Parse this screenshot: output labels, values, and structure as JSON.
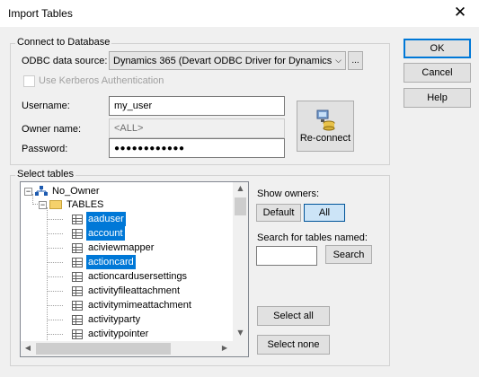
{
  "window": {
    "title": "Import Tables",
    "close_glyph": "✕"
  },
  "right_buttons": {
    "ok": "OK",
    "cancel": "Cancel",
    "help": "Help"
  },
  "connect": {
    "group_label": "Connect to Database",
    "odbc_label": "ODBC data source:",
    "odbc_value": "Dynamics 365 (Devart ODBC Driver for Dynamics 3",
    "browse_label": "...",
    "kerberos_label": "Use Kerberos Authentication",
    "username_label": "Username:",
    "username_value": "my_user",
    "owner_label": "Owner name:",
    "owner_value": "<ALL>",
    "password_label": "Password:",
    "password_value": "●●●●●●●●●●●●",
    "reconnect_label": "Re-connect"
  },
  "select": {
    "group_label": "Select tables",
    "tree": {
      "root": "No_Owner",
      "folder": "TABLES",
      "items": [
        {
          "name": "aaduser",
          "selected": true
        },
        {
          "name": "account",
          "selected": true
        },
        {
          "name": "aciviewmapper",
          "selected": false
        },
        {
          "name": "actioncard",
          "selected": true
        },
        {
          "name": "actioncardusersettings",
          "selected": false
        },
        {
          "name": "activityfileattachment",
          "selected": false
        },
        {
          "name": "activitymimeattachment",
          "selected": false
        },
        {
          "name": "activityparty",
          "selected": false
        },
        {
          "name": "activitypointer",
          "selected": false
        }
      ]
    },
    "show_owners_label": "Show owners:",
    "default_label": "Default",
    "all_label": "All",
    "search_label": "Search for tables named:",
    "search_value": "",
    "search_button": "Search",
    "select_all": "Select all",
    "select_none": "Select none"
  },
  "colors": {
    "selection": "#0078d7",
    "accent": "#0078d7"
  }
}
